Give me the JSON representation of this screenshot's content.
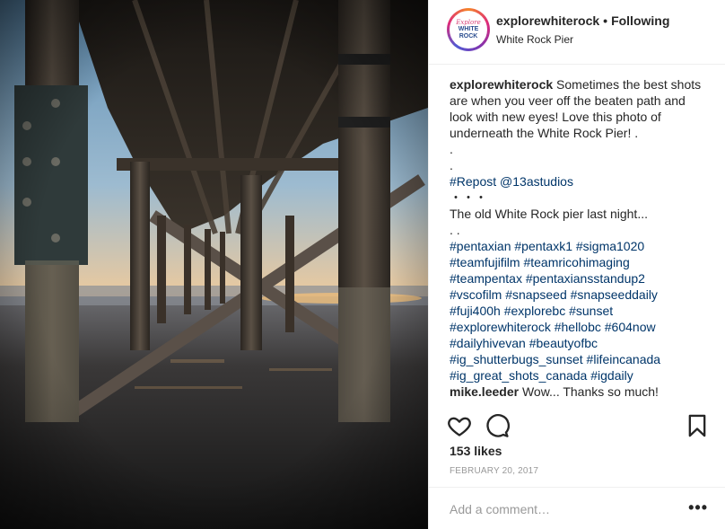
{
  "post": {
    "image_alt": "Underneath the White Rock Pier at sunset"
  },
  "header": {
    "avatar_line1": "Explore",
    "avatar_line2": "WHITE",
    "avatar_line3": "ROCK",
    "username": "explorewhiterock",
    "separator": "•",
    "follow_label": "Following",
    "location": "White Rock Pier"
  },
  "caption": {
    "username": "explorewhiterock",
    "text": "Sometimes the best shots are when you veer off the beaten path and look with new eyes! Love this photo of underneath the White Rock Pier! .",
    "dot1": ".",
    "dot2": ".",
    "repost": "#Repost @13astudios",
    "dots3": "・・・",
    "line": "The old White Rock pier last night...",
    "dots4": ". .",
    "hashtags": [
      "#pentaxian #pentaxk1 #sigma1020",
      "#teamfujifilm #teamricohimaging",
      "#teampentax #pentaxiansstandup2",
      "#vscofilm #snapseed #snapseeddaily",
      "#fuji400h #explorebc #sunset",
      "#explorewhiterock #hellobc #604now",
      "#dailyhivevan #beautyofbc",
      "#ig_shutterbugs_sunset #lifeincanada",
      "#ig_great_shots_canada #igdaily"
    ]
  },
  "comment": {
    "username": "mike.leeder",
    "text": "Wow... Thanks so much!"
  },
  "actions": {
    "like_icon": "heart-outline-icon",
    "comment_icon": "speech-bubble-icon",
    "save_icon": "bookmark-icon"
  },
  "likes": "153 likes",
  "date": "FEBRUARY 20, 2017",
  "add_comment": {
    "placeholder": "Add a comment…",
    "more_label": "•••"
  }
}
